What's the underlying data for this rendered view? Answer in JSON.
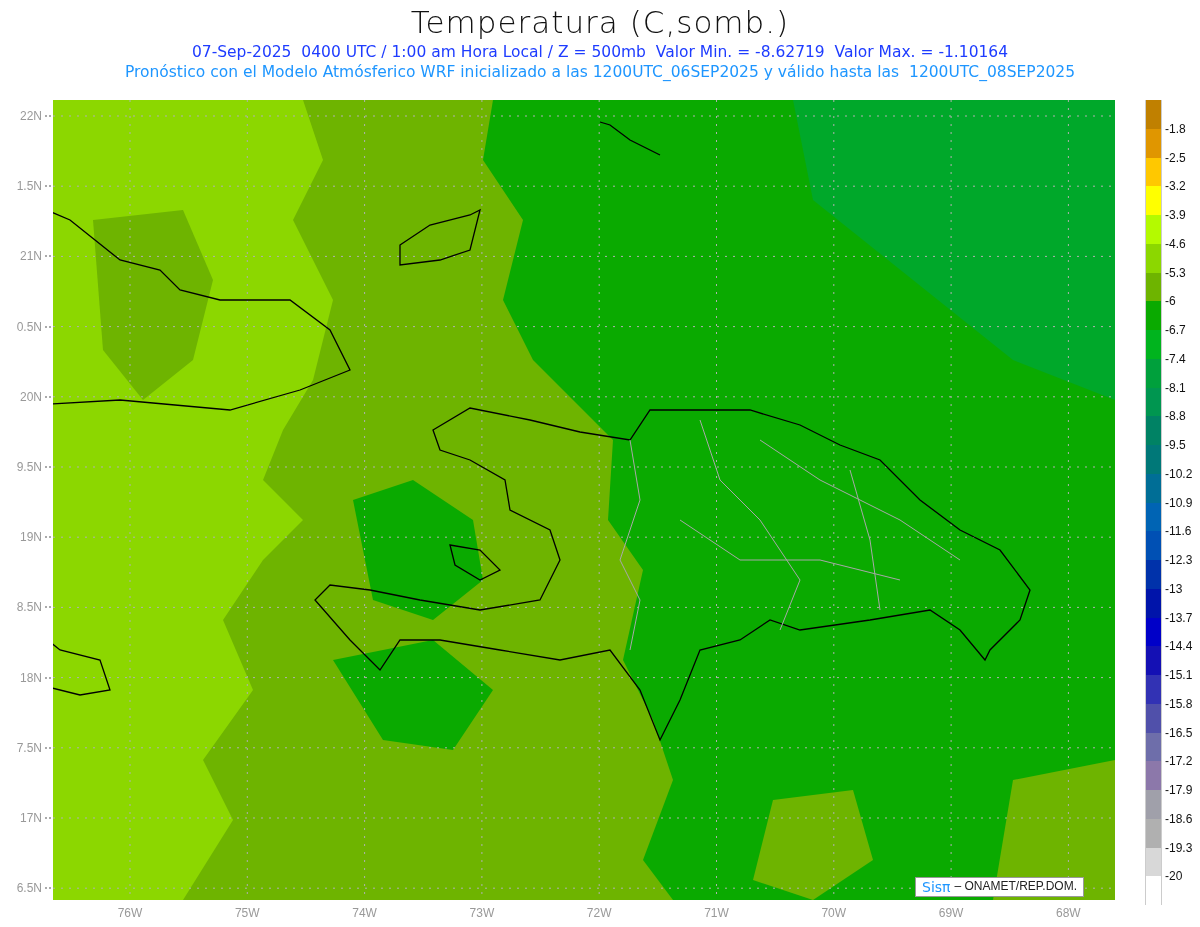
{
  "title": "Temperatura (C,somb.)",
  "subtitle_lines": [
    "07-Sep-2025  0400 UTC / 1:00 am Hora Local / Z = 500mb  Valor Min. = -8.62719  Valor Max. = -1.10164",
    "Pronóstico con el Modelo Atmósferico WRF inicializado a las 1200UTC_06SEP2025 y válido hasta las  1200UTC_08SEP2025"
  ],
  "map": {
    "lat_labels": [
      "22N",
      "1.5N",
      "21N",
      "0.5N",
      "20N",
      "9.5N",
      "19N",
      "8.5N",
      "18N",
      "7.5N",
      "17N",
      "6.5N"
    ],
    "lon_labels": [
      "76W",
      "75W",
      "74W",
      "73W",
      "72W",
      "71W",
      "70W",
      "69W",
      "68W"
    ],
    "credit": {
      "logo": "Sisπ",
      "text": "– ONAMET/REP.DOM."
    }
  },
  "legend": [
    {
      "color": "#c08000",
      "label": "-1.8"
    },
    {
      "color": "#e09600",
      "label": "-2.5"
    },
    {
      "color": "#ffc800",
      "label": "-3.2"
    },
    {
      "color": "#ffff00",
      "label": "-3.9"
    },
    {
      "color": "#b4fa00",
      "label": "-4.6"
    },
    {
      "color": "#8cd700",
      "label": "-5.3"
    },
    {
      "color": "#6eb400",
      "label": "-6"
    },
    {
      "color": "#0aaa00",
      "label": "-6.7"
    },
    {
      "color": "#00b41e",
      "label": "-7.4"
    },
    {
      "color": "#00a03c",
      "label": "-8.1"
    },
    {
      "color": "#009650",
      "label": "-8.8"
    },
    {
      "color": "#008264",
      "label": "-9.5"
    },
    {
      "color": "#007878",
      "label": "-10.2"
    },
    {
      "color": "#006e96",
      "label": "-10.9"
    },
    {
      "color": "#0064b4",
      "label": "-11.6"
    },
    {
      "color": "#0050b4",
      "label": "-12.3"
    },
    {
      "color": "#0032aa",
      "label": "-13"
    },
    {
      "color": "#0014aa",
      "label": "-13.7"
    },
    {
      "color": "#0000c8",
      "label": "-14.4"
    },
    {
      "color": "#1410b4",
      "label": "-15.1"
    },
    {
      "color": "#3232b4",
      "label": "-15.8"
    },
    {
      "color": "#5050aa",
      "label": "-16.5"
    },
    {
      "color": "#6e6eaa",
      "label": "-17.2"
    },
    {
      "color": "#8c78aa",
      "label": "-17.9"
    },
    {
      "color": "#a0a0aa",
      "label": "-18.6"
    },
    {
      "color": "#b0b0b0",
      "label": "-19.3"
    },
    {
      "color": "#d8d8d8",
      "label": "-20"
    },
    {
      "color": "#ffffff"
    }
  ]
}
